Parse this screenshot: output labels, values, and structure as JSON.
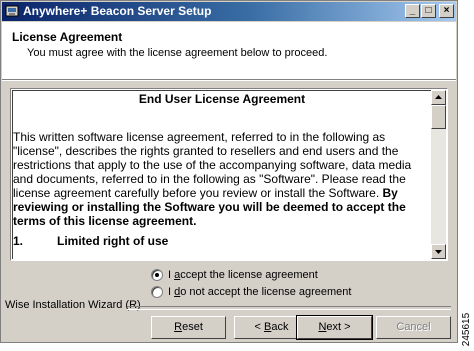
{
  "window": {
    "title": "Anywhere+ Beacon Server Setup",
    "controls": {
      "minimize": "_",
      "maximize": "□",
      "close": "×"
    }
  },
  "header": {
    "title": "License Agreement",
    "subtitle": "You must agree with the license agreement below to proceed."
  },
  "license": {
    "heading": "End User License Agreement",
    "body_plain": "This written software license agreement, referred to in the following as \"license\", describes the rights granted to resellers and end users and the restrictions that apply to the use of the accompanying software, data media and documents, referred to in the following as \"Software\".  Please read the license agreement carefully before you review or install the Software. ",
    "body_bold": "By reviewing or installing the Software you will be deemed to accept the terms of this license agreement.",
    "section_number": "1.",
    "section_title": "Limited right of use",
    "scrollbar": {
      "up": "▲",
      "down": "▼"
    }
  },
  "options": {
    "accept": {
      "prefix": "I ",
      "accel": "a",
      "rest": "ccept the license agreement",
      "selected": true
    },
    "decline": {
      "prefix": "I ",
      "accel": "d",
      "rest": "o not accept the license agreement",
      "selected": false
    }
  },
  "footer": {
    "brand": "Wise Installation Wizard (R)",
    "buttons": {
      "reset": {
        "accel": "R",
        "rest": "eset"
      },
      "back": {
        "pre": "< ",
        "accel": "B",
        "rest": "ack"
      },
      "next": {
        "accel": "N",
        "rest": "ext >"
      },
      "cancel": "Cancel"
    }
  },
  "figure_code": "245615",
  "colors": {
    "title_gradient_start": "#0a246a",
    "title_gradient_end": "#a6caf0",
    "face": "#d4d0c8"
  }
}
